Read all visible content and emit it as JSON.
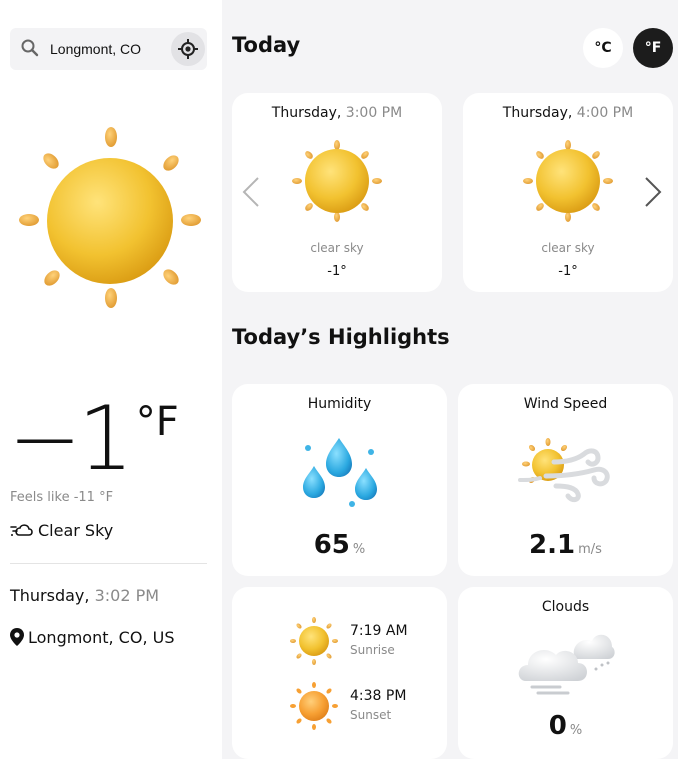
{
  "search": {
    "value": "Longmont, CO"
  },
  "current": {
    "temp": "−1",
    "unit": "°F",
    "feels_like": "Feels like -11 °F",
    "condition": "Clear Sky",
    "day": "Thursday,",
    "time": "3:02 PM",
    "location": "Longmont, CO, US"
  },
  "header": {
    "title": "Today",
    "unit_c": "°C",
    "unit_f": "°F"
  },
  "hourly": [
    {
      "day": "Thursday,",
      "time": "3:00 PM",
      "desc": "clear sky",
      "temp": "-1°"
    },
    {
      "day": "Thursday,",
      "time": "4:00 PM",
      "desc": "clear sky",
      "temp": "-1°"
    }
  ],
  "highlights": {
    "title": "Today’s Highlights",
    "humidity": {
      "label": "Humidity",
      "value": "65",
      "unit": "%"
    },
    "wind": {
      "label": "Wind Speed",
      "value": "2.1",
      "unit": "m/s"
    },
    "sunrise": {
      "time": "7:19 AM",
      "label": "Sunrise"
    },
    "sunset": {
      "time": "4:38 PM",
      "label": "Sunset"
    },
    "clouds": {
      "label": "Clouds",
      "value": "0",
      "unit": "%"
    }
  },
  "colors": {
    "sun": "#f2c230",
    "sun_dark": "#e0a018",
    "sunset": "#f7a033",
    "water": "#3fb4e6",
    "accent_dark": "#1c1c1c"
  },
  "icons": [
    "search-icon",
    "locate-icon",
    "sun-icon",
    "wind-icon",
    "location-pin-icon",
    "chevron-left-icon",
    "chevron-right-icon",
    "water-drops-icon",
    "sun-wind-icon",
    "cloud-icon"
  ]
}
